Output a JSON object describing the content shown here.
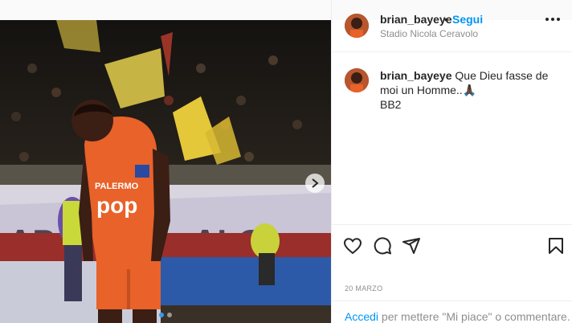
{
  "post": {
    "username": "brian_bayeye",
    "bullet": "•",
    "follow_label": "Segui",
    "location": "Stadio Nicola Ceravolo",
    "caption_text": "Que Dieu fasse de moi un Homme..🙏🏿",
    "caption_line2": "BB2",
    "date": "20 MARZO",
    "login_link": "Accedi",
    "login_rest": " per mettere \"Mi piace\" o commentare."
  },
  "media": {
    "sponsor_top": "PALERMO",
    "sponsor_main": "pop",
    "carousel_count": 2,
    "carousel_active": 1
  },
  "icons": {
    "like": "heart-icon",
    "comment": "comment-icon",
    "share": "share-icon",
    "save": "bookmark-icon",
    "more": "more-icon",
    "next": "chevron-right-icon"
  },
  "colors": {
    "link": "#0095f6",
    "text": "#262626",
    "muted": "#8e8e8e",
    "jersey": "#e8622a"
  }
}
